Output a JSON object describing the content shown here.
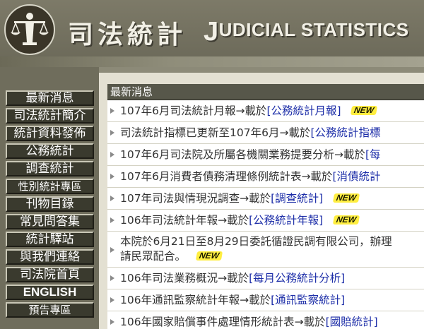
{
  "header": {
    "title_zh": "司法統計",
    "title_en_first": "J",
    "title_en_rest": "UDICIAL STATISTICS"
  },
  "nav": {
    "items": [
      {
        "label": "最新消息"
      },
      {
        "label": "司法統計簡介"
      },
      {
        "label": "統計資料發佈"
      },
      {
        "label": "公務統計"
      },
      {
        "label": "調查統計"
      },
      {
        "label": "性別統計專區"
      },
      {
        "label": "刊物目錄"
      },
      {
        "label": "常見問答集"
      },
      {
        "label": "統計驛站"
      },
      {
        "label": "與我們連絡"
      },
      {
        "label": "司法院首頁"
      },
      {
        "label": "ENGLISH"
      },
      {
        "label": "預告專區"
      }
    ]
  },
  "news": {
    "heading": "最新消息",
    "new_label": "NEW",
    "items": [
      {
        "text": "107年6月司法統計月報→載於",
        "link": "[公務統計月報]",
        "is_new": true
      },
      {
        "text": "司法統計指標已更新至107年6月→載於",
        "link": "[公務統計指標",
        "is_new": false
      },
      {
        "text": "107年6月司法院及所屬各機關業務提要分析→載於",
        "link": "[每",
        "is_new": false
      },
      {
        "text": "107年6月消費者債務清理條例統計表→載於",
        "link": "[消債統計",
        "is_new": false
      },
      {
        "text": "107年司法與情現況調查→載於",
        "link": "[調查統計]",
        "is_new": true
      },
      {
        "text": "106年司法統計年報→載於",
        "link": "[公務統計年報]",
        "is_new": true
      },
      {
        "text": "本院於6月21日至8月29日委託循證民調有限公司，辦理",
        "text2": "請民眾配合。",
        "link": "",
        "is_new": true
      },
      {
        "text": "106年司法業務概況→載於",
        "link": "[每月公務統計分析]",
        "is_new": false
      },
      {
        "text": "106年通訊監察統計年報→載於",
        "link": "[通訊監察統計]",
        "is_new": false
      },
      {
        "text": "106年國家賠償事件處理情形統計表→載於",
        "link": "[國賠統計]",
        "is_new": false
      }
    ]
  },
  "colors": {
    "header_bg": "#7d7a68",
    "nav_button_bg": "#3a3a2e",
    "section_head_bg": "#57574a",
    "link": "#1d2ea8",
    "new_badge": "#ffee40"
  },
  "icons": {
    "logo": "scales-of-justice-icon",
    "bullet": "triangle-right-icon"
  }
}
